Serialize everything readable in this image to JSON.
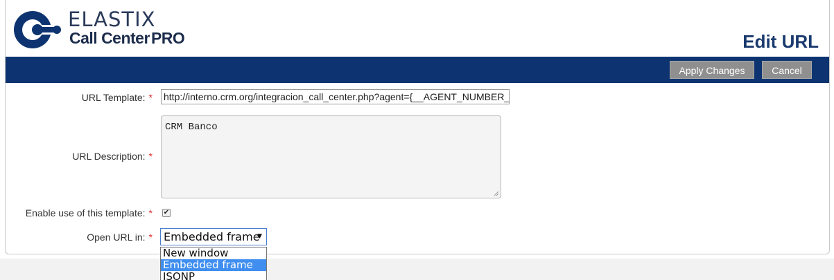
{
  "header": {
    "logo_line1": "ELASTIX",
    "logo_line2": "Call Center",
    "logo_line2_bold": "PRO",
    "title": "Edit URL"
  },
  "toolbar": {
    "apply_label": "Apply Changes",
    "cancel_label": "Cancel"
  },
  "form": {
    "required_mark": "*",
    "url_template": {
      "label": "URL Template:",
      "value": "http://interno.crm.org/integracion_call_center.php?agent={__AGENT_NUMBER__}"
    },
    "url_description": {
      "label": "URL Description:",
      "value": "CRM Banco"
    },
    "enable": {
      "label": "Enable use of this template:",
      "checked": true
    },
    "open_in": {
      "label": "Open URL in:",
      "selected": "Embedded frame",
      "options": [
        "New window",
        "Embedded frame",
        "JSONP"
      ]
    }
  },
  "colors": {
    "nav_bar": "#0d3470",
    "title": "#1a3a6e",
    "required": "#e03030",
    "option_highlight": "#3f8ef0"
  }
}
